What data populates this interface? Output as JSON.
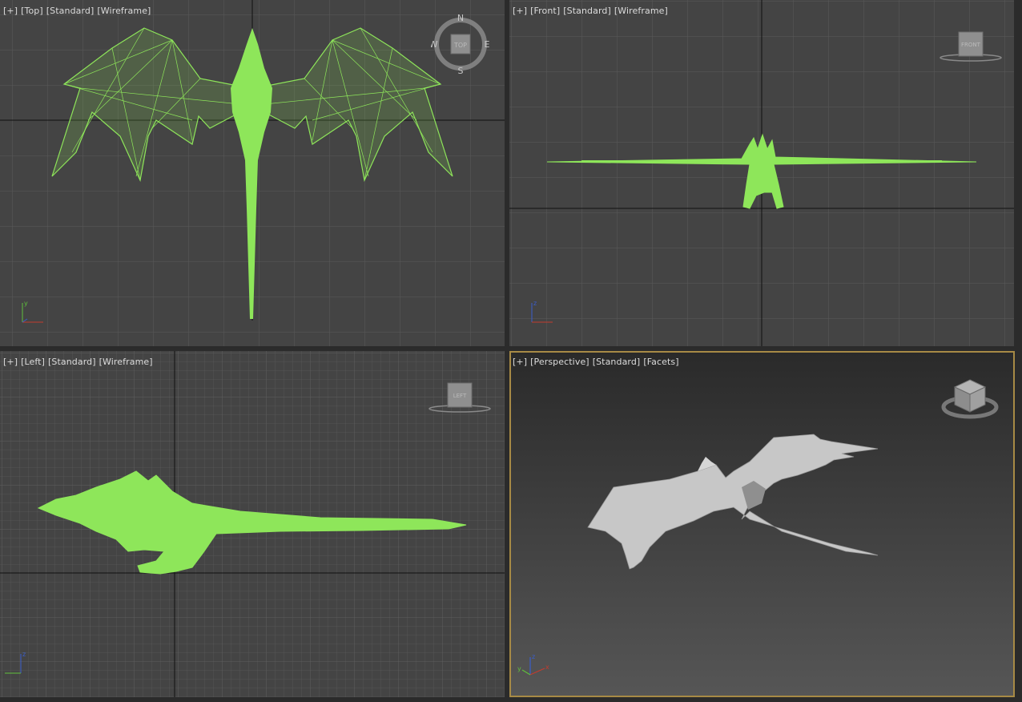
{
  "viewports": {
    "top": {
      "plus": "[+]",
      "view": "[Top]",
      "mode": "[Standard]",
      "shading": "[Wireframe]"
    },
    "front": {
      "plus": "[+]",
      "view": "[Front]",
      "mode": "[Standard]",
      "shading": "[Wireframe]"
    },
    "left": {
      "plus": "[+]",
      "view": "[Left]",
      "mode": "[Standard]",
      "shading": "[Wireframe]"
    },
    "perspective": {
      "plus": "[+]",
      "view": "[Perspective]",
      "mode": "[Standard]",
      "shading": "[Facets]"
    }
  },
  "compass": {
    "n": "N",
    "s": "S",
    "e": "E",
    "w": "W",
    "top_label": "TOP"
  },
  "viewcube": {
    "front_label": "FRONT",
    "left_label": "LEFT"
  },
  "axes": {
    "x": "x",
    "y": "y",
    "z": "z"
  },
  "colors": {
    "wireframe": "#8ee65a",
    "grid": "#5a5a5a",
    "grid_fine": "#555555",
    "axis_line": "#111111",
    "viewport_bg": "#444444",
    "active_border": "#a78a45"
  }
}
